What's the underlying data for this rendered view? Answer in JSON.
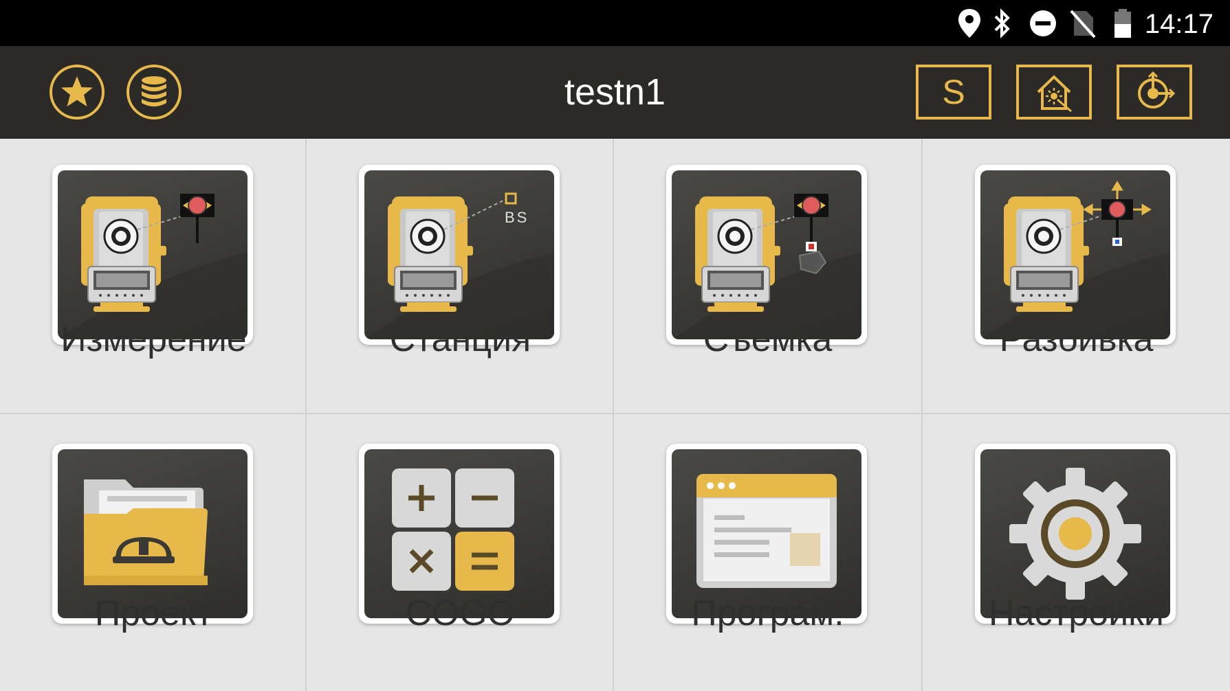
{
  "status_bar": {
    "time": "14:17",
    "icons": [
      "location-pin-icon",
      "bluetooth-icon",
      "do-not-disturb-icon",
      "no-sim-icon",
      "battery-icon"
    ]
  },
  "app_bar": {
    "title": "testn1",
    "left_buttons": [
      "favorites-star-icon",
      "database-icon"
    ],
    "right_buttons": [
      {
        "label": "S",
        "icon": "s-button"
      },
      {
        "label": "",
        "icon": "house-laser-icon"
      },
      {
        "label": "",
        "icon": "target-crosshair-icon"
      }
    ]
  },
  "menu": {
    "items": [
      {
        "label": "Измерение",
        "icon": "measure-icon"
      },
      {
        "label": "Станция",
        "icon": "station-icon"
      },
      {
        "label": "Съемка",
        "icon": "survey-icon"
      },
      {
        "label": "Разбивка",
        "icon": "stakeout-icon"
      },
      {
        "label": "Проект",
        "icon": "project-folder-icon"
      },
      {
        "label": "COGO",
        "icon": "cogo-calculator-icon"
      },
      {
        "label": "Програм.",
        "icon": "programs-window-icon"
      },
      {
        "label": "Настройки",
        "icon": "settings-gear-icon"
      }
    ]
  },
  "station_tile_text": "BS",
  "colors": {
    "accent": "#e7b94a",
    "appbar": "#2b2a27",
    "statusbar": "#000000",
    "grid_background": "#e6e6e6",
    "label_text": "#2f2f2f"
  }
}
